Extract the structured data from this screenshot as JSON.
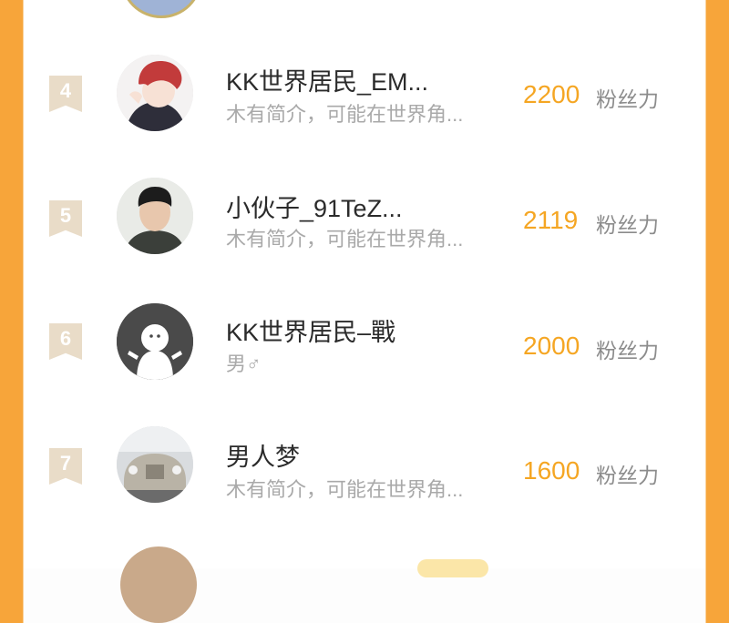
{
  "rows": [
    {
      "rank": "4",
      "name": "KK世界居民_EM...",
      "desc": "木有简介，可能在世界角...",
      "count": "2200",
      "unit": "粉丝力",
      "avatar_icon": "red-haired-anime-character"
    },
    {
      "rank": "5",
      "name": "小伙子_91TeZ...",
      "desc": "木有简介，可能在世界角...",
      "count": "2119",
      "unit": "粉丝力",
      "avatar_icon": "young-man-photo"
    },
    {
      "rank": "6",
      "name": "KK世界居民–戰",
      "desc": "男♂",
      "count": "2000",
      "unit": "粉丝力",
      "avatar_icon": "default-user-avatar"
    },
    {
      "rank": "7",
      "name": "男人梦",
      "desc": "木有简介，可能在世界角...",
      "count": "1600",
      "unit": "粉丝力",
      "avatar_icon": "luxury-car-photo"
    }
  ],
  "colors": {
    "frame": "#f7a53a",
    "count": "#f5a623",
    "rank_badge": "#e9dcc8"
  }
}
